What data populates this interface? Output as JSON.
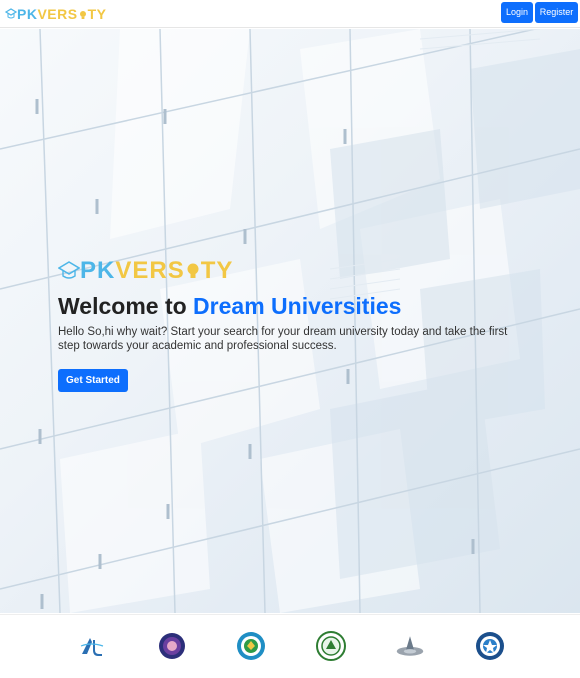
{
  "navbar": {
    "brand": {
      "part1": "PK",
      "part2": "VERS",
      "part3": "TY",
      "icon": "bulb-icon"
    },
    "login_label": "Login",
    "register_label": "Register"
  },
  "hero": {
    "logo": {
      "part1": "PK",
      "part2": "VERS",
      "part3": "TY",
      "icon": "bulb-icon"
    },
    "title_prefix": "Welcome to ",
    "title_accent": "Dream Universities",
    "description": "Hello So,hi why wait? Start your search for your dream university today and take the first step towards your academic and professional success.",
    "cta_label": "Get Started"
  },
  "universities": [
    {
      "icon": "university-logo-1"
    },
    {
      "icon": "university-logo-2"
    },
    {
      "icon": "university-logo-3"
    },
    {
      "icon": "university-logo-4"
    },
    {
      "icon": "university-logo-5"
    },
    {
      "icon": "university-logo-6"
    }
  ],
  "colors": {
    "primary": "#0d6efd",
    "brand_blue": "#4db6e8",
    "brand_yellow": "#f2c744",
    "title_dark": "#222222"
  }
}
